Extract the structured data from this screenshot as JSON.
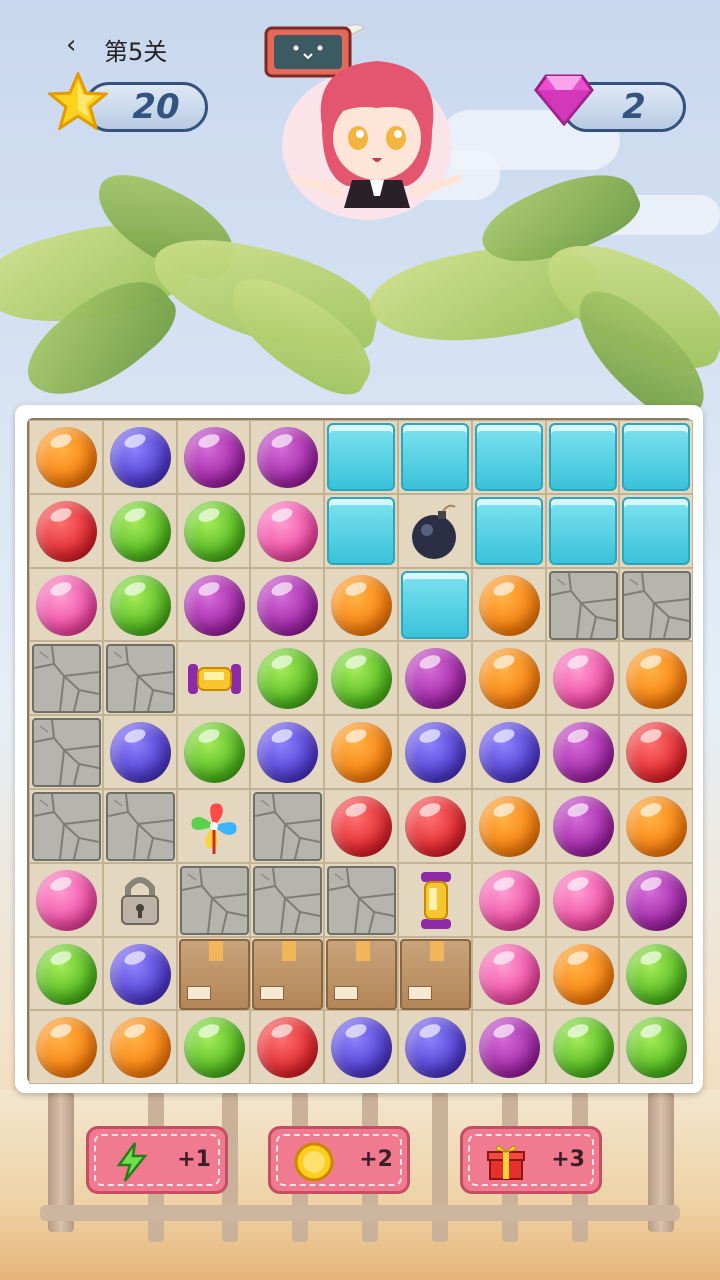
{
  "header": {
    "back_icon": "chevron-left",
    "level_label": "第5关",
    "stars": "20",
    "gems": "2"
  },
  "board": {
    "rows": 9,
    "cols": 9,
    "cells": [
      [
        "orange",
        "blue",
        "purple",
        "purple",
        "ice",
        "ice",
        "ice",
        "ice",
        "ice"
      ],
      [
        "red",
        "green",
        "green",
        "pink",
        "ice",
        "bomb",
        "ice",
        "ice",
        "ice"
      ],
      [
        "pink",
        "green",
        "purple",
        "purple",
        "orange",
        "ice",
        "orange",
        "stone",
        "stone"
      ],
      [
        "stone",
        "stone",
        "lantern-horizontal",
        "green",
        "green",
        "purple",
        "orange",
        "pink",
        "orange"
      ],
      [
        "stone",
        "blue",
        "green",
        "blue",
        "orange",
        "blue",
        "blue",
        "purple",
        "red"
      ],
      [
        "stone",
        "stone",
        "pinwheel",
        "stone",
        "red",
        "red",
        "orange",
        "purple",
        "orange"
      ],
      [
        "pink",
        "padlock",
        "stone",
        "stone",
        "stone",
        "lantern-vertical",
        "pink",
        "pink",
        "purple"
      ],
      [
        "green",
        "blue",
        "crate",
        "crate",
        "crate",
        "crate",
        "pink",
        "orange",
        "green"
      ],
      [
        "orange",
        "orange",
        "green",
        "red",
        "blue",
        "blue",
        "purple",
        "green",
        "green"
      ]
    ]
  },
  "boosters": [
    {
      "icon": "lightning-icon",
      "count": "+1"
    },
    {
      "icon": "coin-icon",
      "count": "+2"
    },
    {
      "icon": "gift-icon",
      "count": "+3"
    }
  ],
  "colors": {
    "orange": "#f77a07",
    "blue": "#4a35c9",
    "purple": "#9a1ea0",
    "red": "#dd1f26",
    "green": "#48b218",
    "pink": "#ec3f9d",
    "booster_bg": "#f07a8f",
    "pill_border": "#34527c"
  }
}
